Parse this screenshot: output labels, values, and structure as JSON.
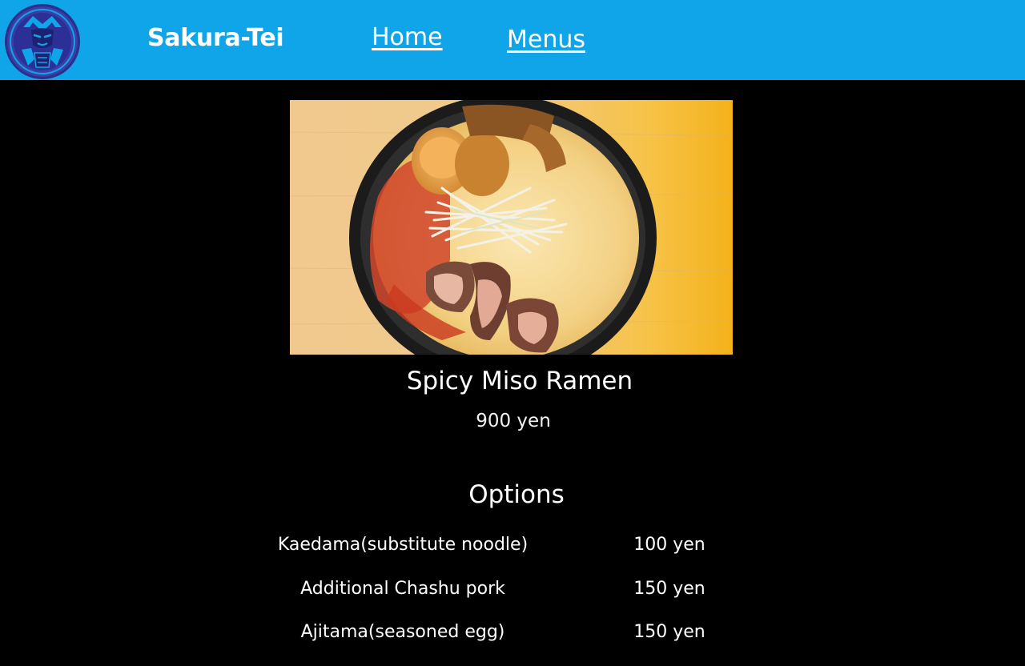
{
  "header": {
    "logo_icon": "samurai-crest-logo",
    "brand": "Sakura-Tei",
    "nav": {
      "home": "Home",
      "menus": "Menus"
    },
    "background_color": "#10a5e9"
  },
  "dish": {
    "image_icon": "spicy-miso-ramen-photo",
    "name": "Spicy Miso Ramen",
    "price": "900 yen"
  },
  "options": {
    "heading": "Options",
    "items": [
      {
        "name": "Kaedama(substitute noodle)",
        "price": "100 yen"
      },
      {
        "name": "Additional Chashu pork",
        "price": "150 yen"
      },
      {
        "name": "Ajitama(seasoned egg)",
        "price": "150 yen"
      }
    ]
  }
}
